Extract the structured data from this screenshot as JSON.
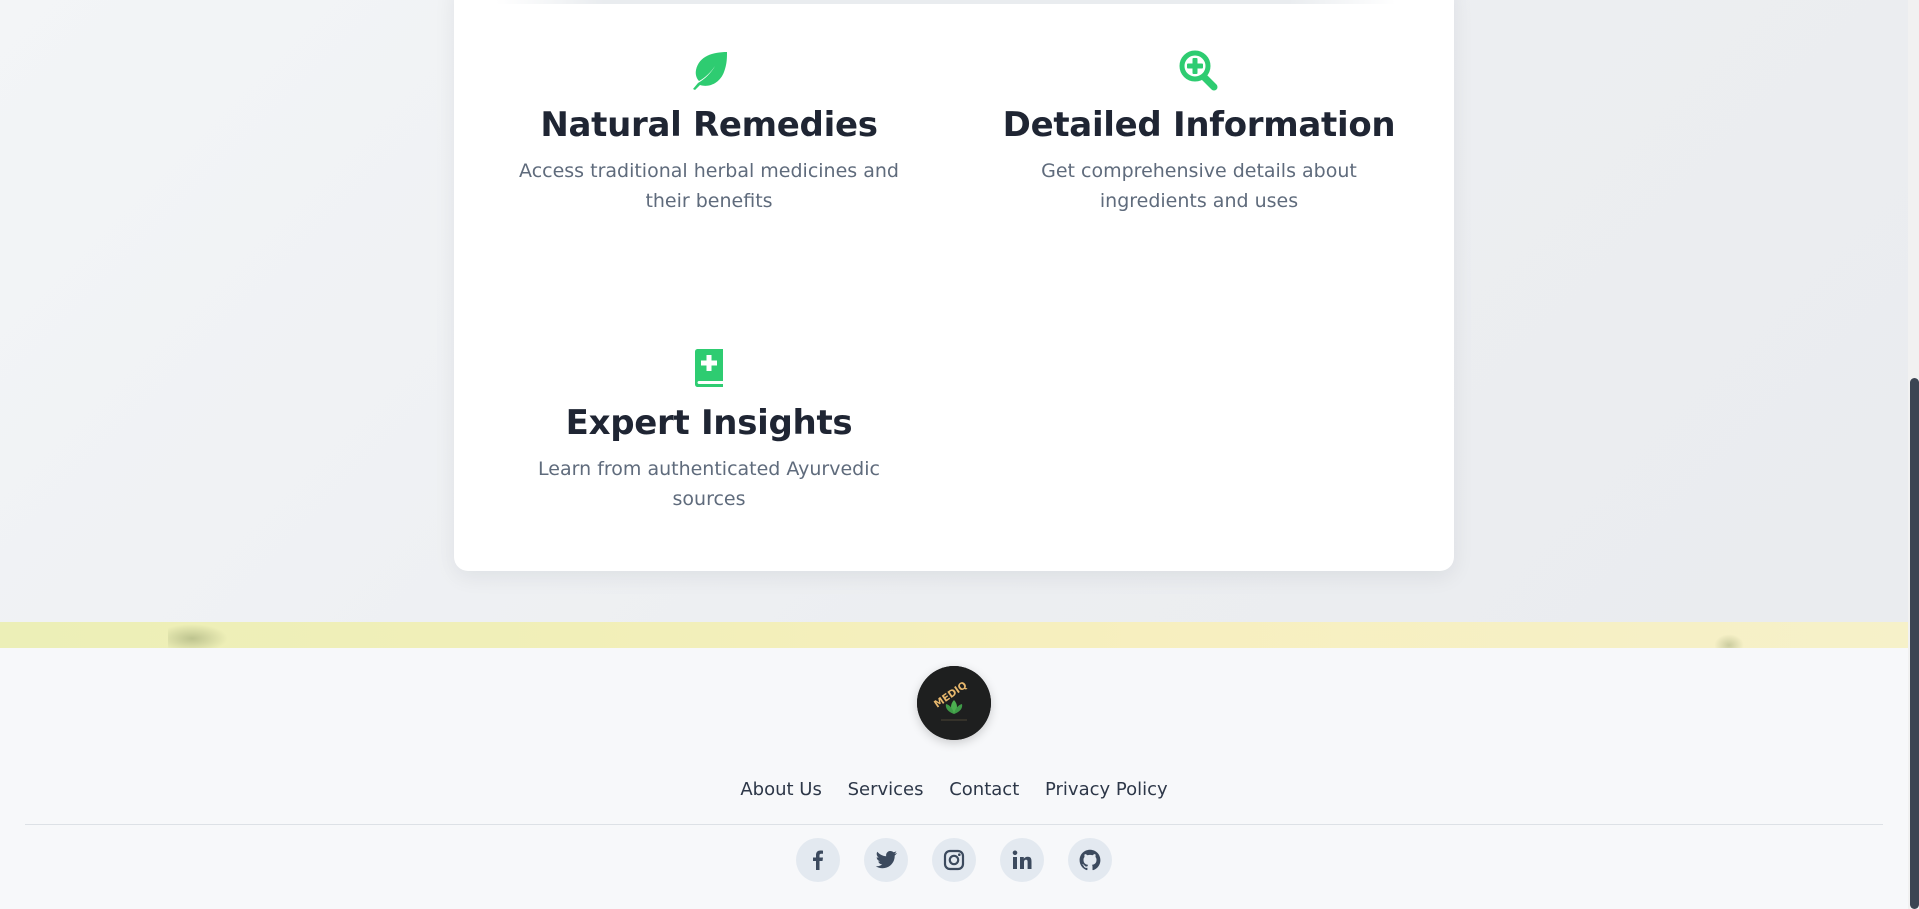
{
  "features": [
    {
      "title": "Natural Remedies",
      "description_line1": "Access traditional herbal medicines and",
      "description_line2": "their benefits",
      "icon": "leaf-icon"
    },
    {
      "title": "Detailed Information",
      "description_line1": "Get comprehensive details about",
      "description_line2": "ingredients and uses",
      "icon": "magnifying-glass-plus-icon"
    },
    {
      "title": "Expert Insights",
      "description_line1": "Learn from authenticated Ayurvedic sources",
      "description_line2": "",
      "icon": "medical-book-icon"
    }
  ],
  "footer": {
    "logo_text": "MEDIQ",
    "links": [
      "About Us",
      "Services",
      "Contact",
      "Privacy Policy"
    ],
    "social": [
      "facebook-icon",
      "twitter-icon",
      "instagram-icon",
      "linkedin-icon",
      "github-icon"
    ]
  },
  "colors": {
    "accent_green": "#2ecc71",
    "heading": "#1f2533",
    "body_text": "#5f6b7c",
    "footer_link": "#2d3748",
    "social_bg": "#e3e9f0",
    "social_icon": "#3c4a5e"
  }
}
